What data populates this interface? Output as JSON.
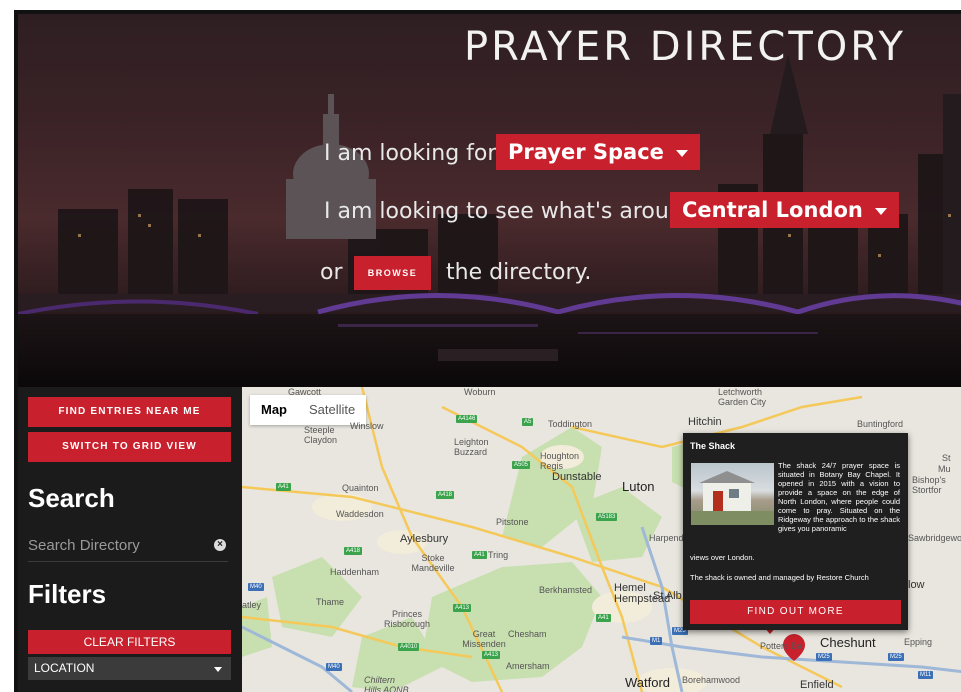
{
  "hero": {
    "title": "PRAYER DIRECTORY",
    "line1_prefix": "I am looking for a",
    "line1_select": "Prayer Space",
    "line2_prefix": "I am looking to see what's around in",
    "line2_select": "Central London",
    "line3_prefix": "or",
    "browse_label": "BROWSE",
    "line3_suffix": "the directory."
  },
  "sidebar": {
    "find_near_me": "FIND ENTRIES NEAR ME",
    "switch_view": "SWITCH TO GRID VIEW",
    "search_heading": "Search",
    "search_placeholder": "Search Directory",
    "filters_heading": "Filters",
    "clear_filters": "CLEAR FILTERS",
    "location_label": "LOCATION"
  },
  "map": {
    "type_map": "Map",
    "type_satellite": "Satellite",
    "towns": {
      "gawcott": "Gawcott",
      "winslow": "Winslow",
      "steeple": "Steeple Claydon",
      "woburn": "Woburn",
      "toddington": "Toddington",
      "letchworth": "Letchworth Garden City",
      "hitchin": "Hitchin",
      "buntingford": "Buntingford",
      "leighton": "Leighton Buzzard",
      "houghton": "Houghton Regis",
      "dunstable": "Dunstable",
      "luton": "Luton",
      "quainton": "Quainton",
      "waddesdon": "Waddesdon",
      "pitstone": "Pitstone",
      "aylesbury": "Aylesbury",
      "harpenden": "Harpende",
      "stoke": "Stoke Mandeville",
      "tring": "Tring",
      "haddenham": "Haddenham",
      "thame": "Thame",
      "berkhamsted": "Berkhamsted",
      "hemel": "Hemel Hempstead",
      "stalb": "St Alb",
      "princes": "Princes Risborough",
      "great_missenden": "Great Missenden",
      "chesham": "Chesham",
      "amersham": "Amersham",
      "chiltern": "Chiltern Hills AONB",
      "watford": "Watford",
      "boreham": "Borehamwood",
      "potters": "Potters Ba",
      "cheshunt": "Cheshunt",
      "epping": "Epping",
      "enfield": "Enfield",
      "sawbridge": "Sawbridgewo",
      "bishops": "Bishop's Stortfor",
      "low": "low",
      "atley": "atley",
      "st": "St",
      "mu": "Mu"
    },
    "roads": {
      "a4146": "A4146",
      "a5": "A5",
      "a505": "A505",
      "a41a": "A41",
      "a418": "A418",
      "a5183": "A5183",
      "a41b": "A41",
      "a418b": "A418",
      "a413": "A413",
      "a4010": "A4010",
      "a413b": "A413",
      "a41c": "A41",
      "m40": "M40",
      "m40b": "M40",
      "m1": "M1",
      "m25": "M25",
      "m25b": "M25",
      "m25c": "M25",
      "m11": "M11"
    }
  },
  "popup": {
    "title": "The Shack",
    "body1": "The shack 24/7 prayer space is situated in Botany Bay Chapel. It opened in 2015 with a vision to provide a space on the edge of North London, where people could come to pray. Situated on the Ridgeway the approach to the shack gives you panoramic",
    "body1_end": "views over London.",
    "body2": "The shack is owned and managed by Restore Church",
    "button": "FIND OUT MORE"
  },
  "colors": {
    "accent_red": "#c8202c",
    "sidebar_bg": "#1b1b1b",
    "map_bg": "#e9e6df"
  },
  "icons": {
    "clear_search": "close-circle-icon",
    "dropdown": "caret-down-icon",
    "map_marker": "map-pin-icon"
  }
}
